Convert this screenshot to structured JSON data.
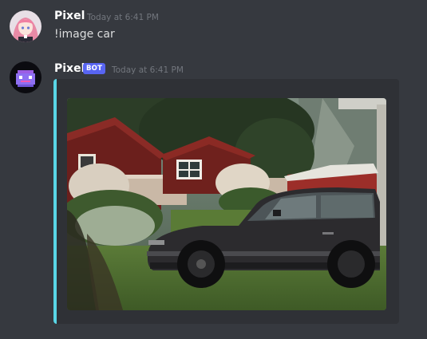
{
  "messages": [
    {
      "username": "Pixel",
      "timestamp": "Today at 6:41 PM",
      "text": "!image car",
      "avatar_icon": "anime-girl-avatar"
    },
    {
      "username": "Pixel",
      "bot_tag": "BOT",
      "timestamp": "Today at 6:41 PM",
      "avatar_icon": "pixel-bot-avatar",
      "embed": {
        "accent_color": "#59d6e6",
        "image_subject": "dark car parked on grass in front of red wooden cabins"
      }
    }
  ],
  "colors": {
    "background": "#36393f",
    "embed_background": "#2f3136",
    "bot_tag": "#5865f2",
    "timestamp": "#72767d"
  }
}
